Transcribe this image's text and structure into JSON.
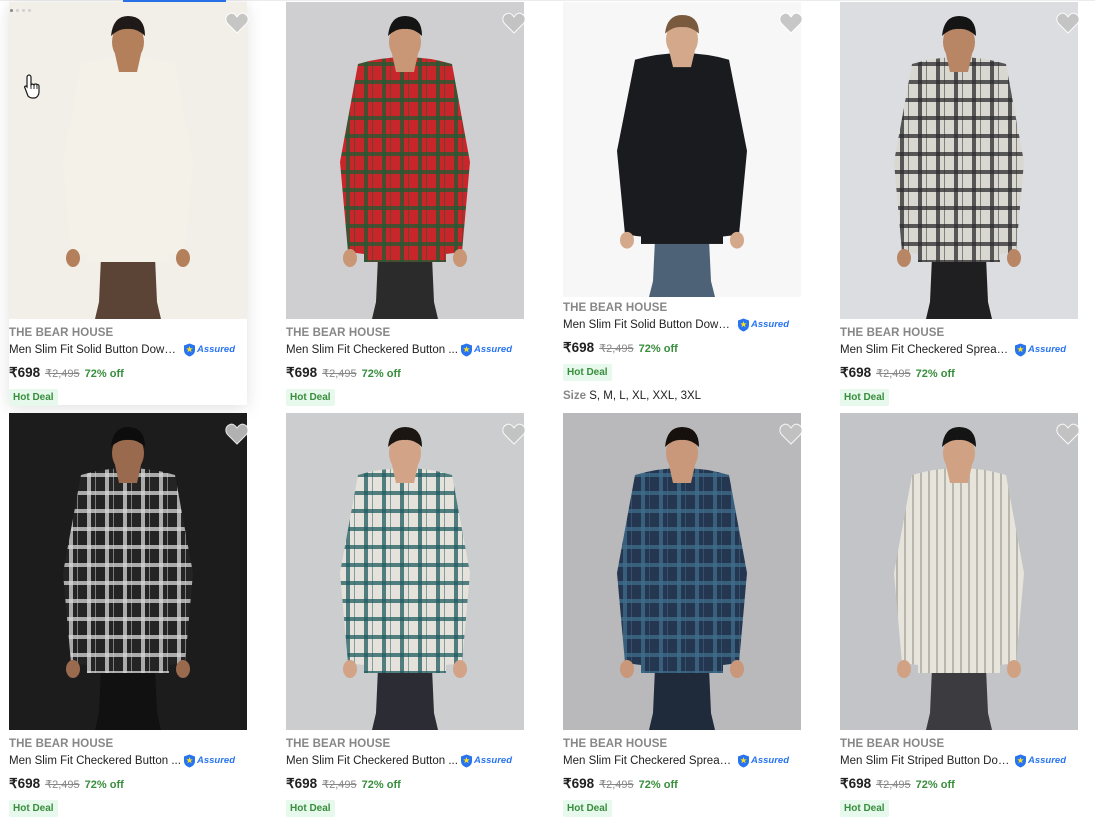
{
  "products": [
    {
      "brand": "THE BEAR HOUSE",
      "title": "Men Slim Fit Solid Button Down ...",
      "price": "₹698",
      "mrp": "₹2,495",
      "discount": "72% off",
      "badge": "Hot Deal",
      "assured": "Assured",
      "bg": "#f2efe9",
      "shirt": "#f4f1e8",
      "pants": "#5b4436",
      "skin": "#b4805c",
      "hair": "#1f1a17"
    },
    {
      "brand": "THE BEAR HOUSE",
      "title": "Men Slim Fit Checkered Button ...",
      "price": "₹698",
      "mrp": "₹2,495",
      "discount": "72% off",
      "badge": "Hot Deal",
      "assured": "Assured",
      "bg": "#cfcfd1",
      "shirt": "#c8262a",
      "pants": "#2b2b2b",
      "skin": "#c99676",
      "hair": "#141414"
    },
    {
      "brand": "THE BEAR HOUSE",
      "title": "Men Slim Fit Solid Button Down ...",
      "price": "₹698",
      "mrp": "₹2,495",
      "discount": "72% off",
      "badge": "Hot Deal",
      "assured": "Assured",
      "sizes_label": "Size",
      "sizes": "S, M, L, XL, XXL, 3XL",
      "bg": "#f7f7f7",
      "shirt": "#1a1b1e",
      "pants": "#4d6276",
      "skin": "#d3a88b",
      "hair": "#7a5a3e"
    },
    {
      "brand": "THE BEAR HOUSE",
      "title": "Men Slim Fit Checkered Spread ...",
      "price": "₹698",
      "mrp": "₹2,495",
      "discount": "72% off",
      "badge": "Hot Deal",
      "assured": "Assured",
      "bg": "#dcdde0",
      "shirt": "#d8d7d0",
      "pants": "#1f1f22",
      "skin": "#b88565",
      "hair": "#141414"
    },
    {
      "brand": "THE BEAR HOUSE",
      "title": "Men Slim Fit Checkered Button ...",
      "price": "₹698",
      "mrp": "₹2,495",
      "discount": "72% off",
      "badge": "Hot Deal",
      "assured": "Assured",
      "bg": "#1c1c1c",
      "shirt": "#242424",
      "pants": "#111111",
      "skin": "#9a6a4e",
      "hair": "#0d0d0d"
    },
    {
      "brand": "THE BEAR HOUSE",
      "title": "Men Slim Fit Checkered Button ...",
      "price": "₹698",
      "mrp": "₹2,495",
      "discount": "72% off",
      "badge": "Hot Deal",
      "assured": "Assured",
      "bg": "#cccdcf",
      "shirt": "#e4e2da",
      "pants": "#2c2c34",
      "skin": "#d2a386",
      "hair": "#1b1612"
    },
    {
      "brand": "THE BEAR HOUSE",
      "title": "Men Slim Fit Checkered Spread ...",
      "price": "₹698",
      "mrp": "₹2,495",
      "discount": "72% off",
      "badge": "Hot Deal",
      "assured": "Assured",
      "bg": "#b9b9bb",
      "shirt": "#243650",
      "pants": "#1f2a3a",
      "skin": "#c9977a",
      "hair": "#17110d"
    },
    {
      "brand": "THE BEAR HOUSE",
      "title": "Men Slim Fit Striped Button Dow...",
      "price": "₹698",
      "mrp": "₹2,495",
      "discount": "72% off",
      "badge": "Hot Deal",
      "assured": "Assured",
      "bg": "#c3c4c7",
      "shirt": "#e7e4dc",
      "pants": "#3b3b40",
      "skin": "#d0a283",
      "hair": "#141414"
    }
  ],
  "icons": {
    "wishlist": "heart-icon",
    "assured": "assured-shield-icon",
    "cursor": "hand-pointer-icon"
  },
  "colors": {
    "accent": "#2874f0",
    "discount": "#388e3c",
    "deal_bg": "#e7f8ec",
    "muted": "#878787"
  }
}
